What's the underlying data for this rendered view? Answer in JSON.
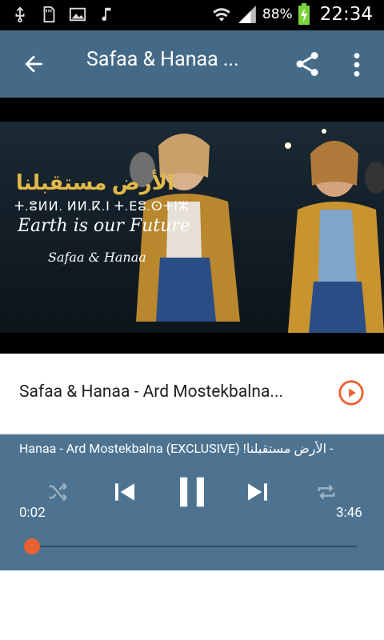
{
  "status_bar": {
    "battery_percent": "88%",
    "time": "22:34"
  },
  "app_bar": {
    "title": "Safaa & Hanaa ..."
  },
  "video": {
    "arabic_title": "الأرض مستقبلنا",
    "tifinagh_line": "ⵜ.ⵓⵍⵍ. ⵍⵍ.ⴽ.ⵏ ⵜ.ⴹⵓ.ⵙⵜⵏⵣ",
    "english_line": "Earth is our Future",
    "signature": "Safaa & Hanaa"
  },
  "track": {
    "title": "Safaa & Hanaa - Ard Mostekbalna..."
  },
  "player": {
    "marquee": "Hanaa - Ard Mostekbalna (EXCLUSIVE) !الأرض مستقبلنا -",
    "current_time": "0:02",
    "total_time": "3:46",
    "progress_fraction": 0.009
  },
  "colors": {
    "app_bar": "#456a87",
    "player": "#4d7391",
    "accent": "#e9622f"
  }
}
